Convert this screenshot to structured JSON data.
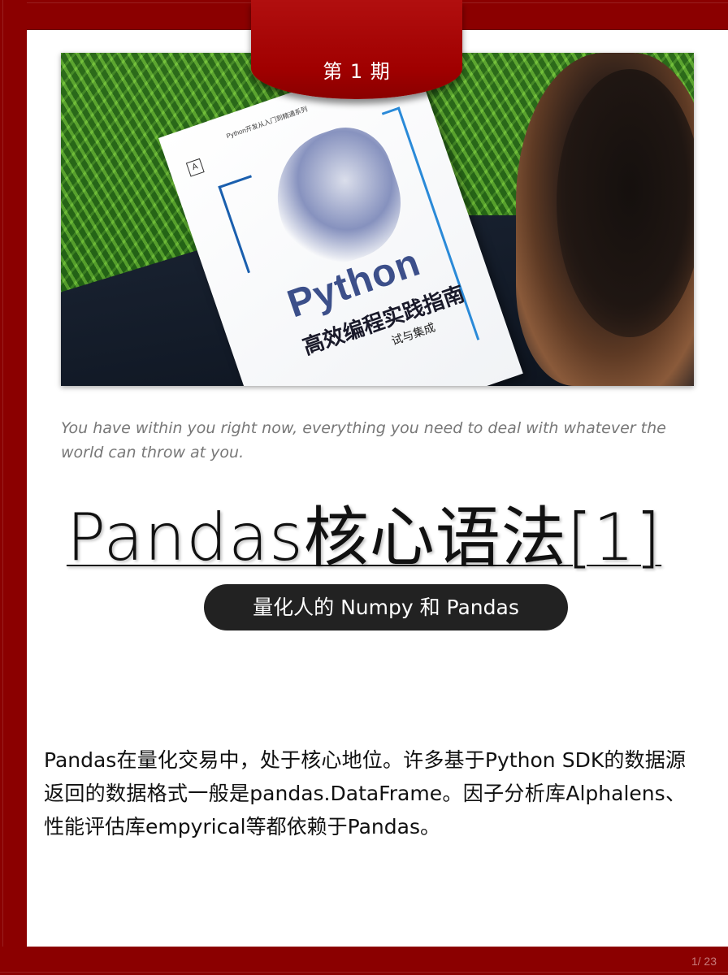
{
  "issue_label": "第 1 期",
  "book_cover": {
    "series": "Python开发从入门到精通系列",
    "logo": "A",
    "title": "Python",
    "subtitle": "高效编程实践指南",
    "subtitle2": "试与集成"
  },
  "quote": "You have within you right now, everything you need to deal with whatever the world can throw at you.",
  "title": "Pandas核心语法[1]",
  "subtitle_pill": "量化人的 Numpy 和 Pandas",
  "body": "Pandas在量化交易中，处于核心地位。许多基于Python SDK的数据源返回的数据格式一般是pandas.DataFrame。因子分析库Alphalens、性能评估库empyrical等都依赖于Pandas。",
  "page_counter": "1/ 23",
  "colors": {
    "frame": "#8b0000",
    "ribbon": "#a00000",
    "pill": "#222222",
    "quote": "#777777"
  }
}
